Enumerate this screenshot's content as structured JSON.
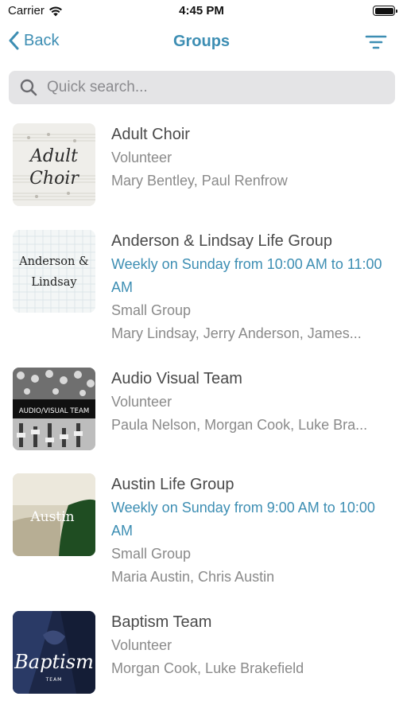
{
  "status_bar": {
    "carrier": "Carrier",
    "time": "4:45 PM"
  },
  "nav": {
    "back_label": "Back",
    "title": "Groups"
  },
  "search": {
    "placeholder": "Quick search..."
  },
  "groups": [
    {
      "name": "Adult Choir",
      "thumb_text": "Adult Choir",
      "type": "Volunteer",
      "members": "Mary Bentley, Paul Renfrow"
    },
    {
      "name": "Anderson & Lindsay Life Group",
      "thumb_text": "Anderson & Lindsay",
      "schedule": "Weekly on Sunday from 10:00 AM to 11:00 AM",
      "type": "Small Group",
      "members": "Mary Lindsay, Jerry Anderson, James..."
    },
    {
      "name": "Audio Visual Team",
      "thumb_text": "AUDIO/VISUAL TEAM",
      "type": "Volunteer",
      "members": "Paula Nelson, Morgan Cook, Luke Bra..."
    },
    {
      "name": "Austin Life Group",
      "thumb_text": "Austin",
      "schedule": "Weekly on Sunday from 9:00 AM to 10:00 AM",
      "type": "Small Group",
      "members": "Maria Austin, Chris Austin"
    },
    {
      "name": "Baptism Team",
      "thumb_text": "Baptism",
      "thumb_subtext": "TEAM",
      "type": "Volunteer",
      "members": "Morgan Cook, Luke Brakefield"
    }
  ],
  "colors": {
    "accent": "#3d8eb3",
    "search_bg": "#e4e4e6"
  }
}
